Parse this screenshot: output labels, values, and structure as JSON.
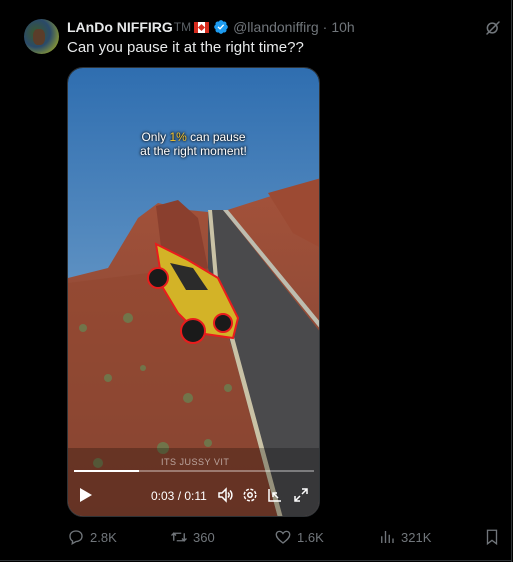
{
  "tweet": {
    "author_name": "LAnDo NIFFIRG",
    "author_suffix": "TM",
    "handle": "@llandoniffirg",
    "time": "10h",
    "separator": "·",
    "text": "Can you pause it at the right time??"
  },
  "video": {
    "overlay_line1_a": "Only ",
    "overlay_highlight": "1%",
    "overlay_line1_b": " can pause",
    "overlay_line2": "at the right moment!",
    "watermark": "ITS JUSSY VIT",
    "time_display": "0:03 / 0:11",
    "progress": 0.27
  },
  "actions": {
    "replies": "2.8K",
    "reposts": "360",
    "likes": "1.6K",
    "views": "321K"
  },
  "colors": {
    "accent_verified": "#1d9bf0",
    "highlight": "#f4c430",
    "secondary_text": "#71767b"
  },
  "icons": [
    "grok-icon",
    "verified-badge-icon",
    "canada-flag-icon",
    "play-icon",
    "volume-icon",
    "settings-icon",
    "pip-icon",
    "fullscreen-icon",
    "reply-icon",
    "repost-icon",
    "like-icon",
    "views-icon",
    "bookmark-icon"
  ]
}
